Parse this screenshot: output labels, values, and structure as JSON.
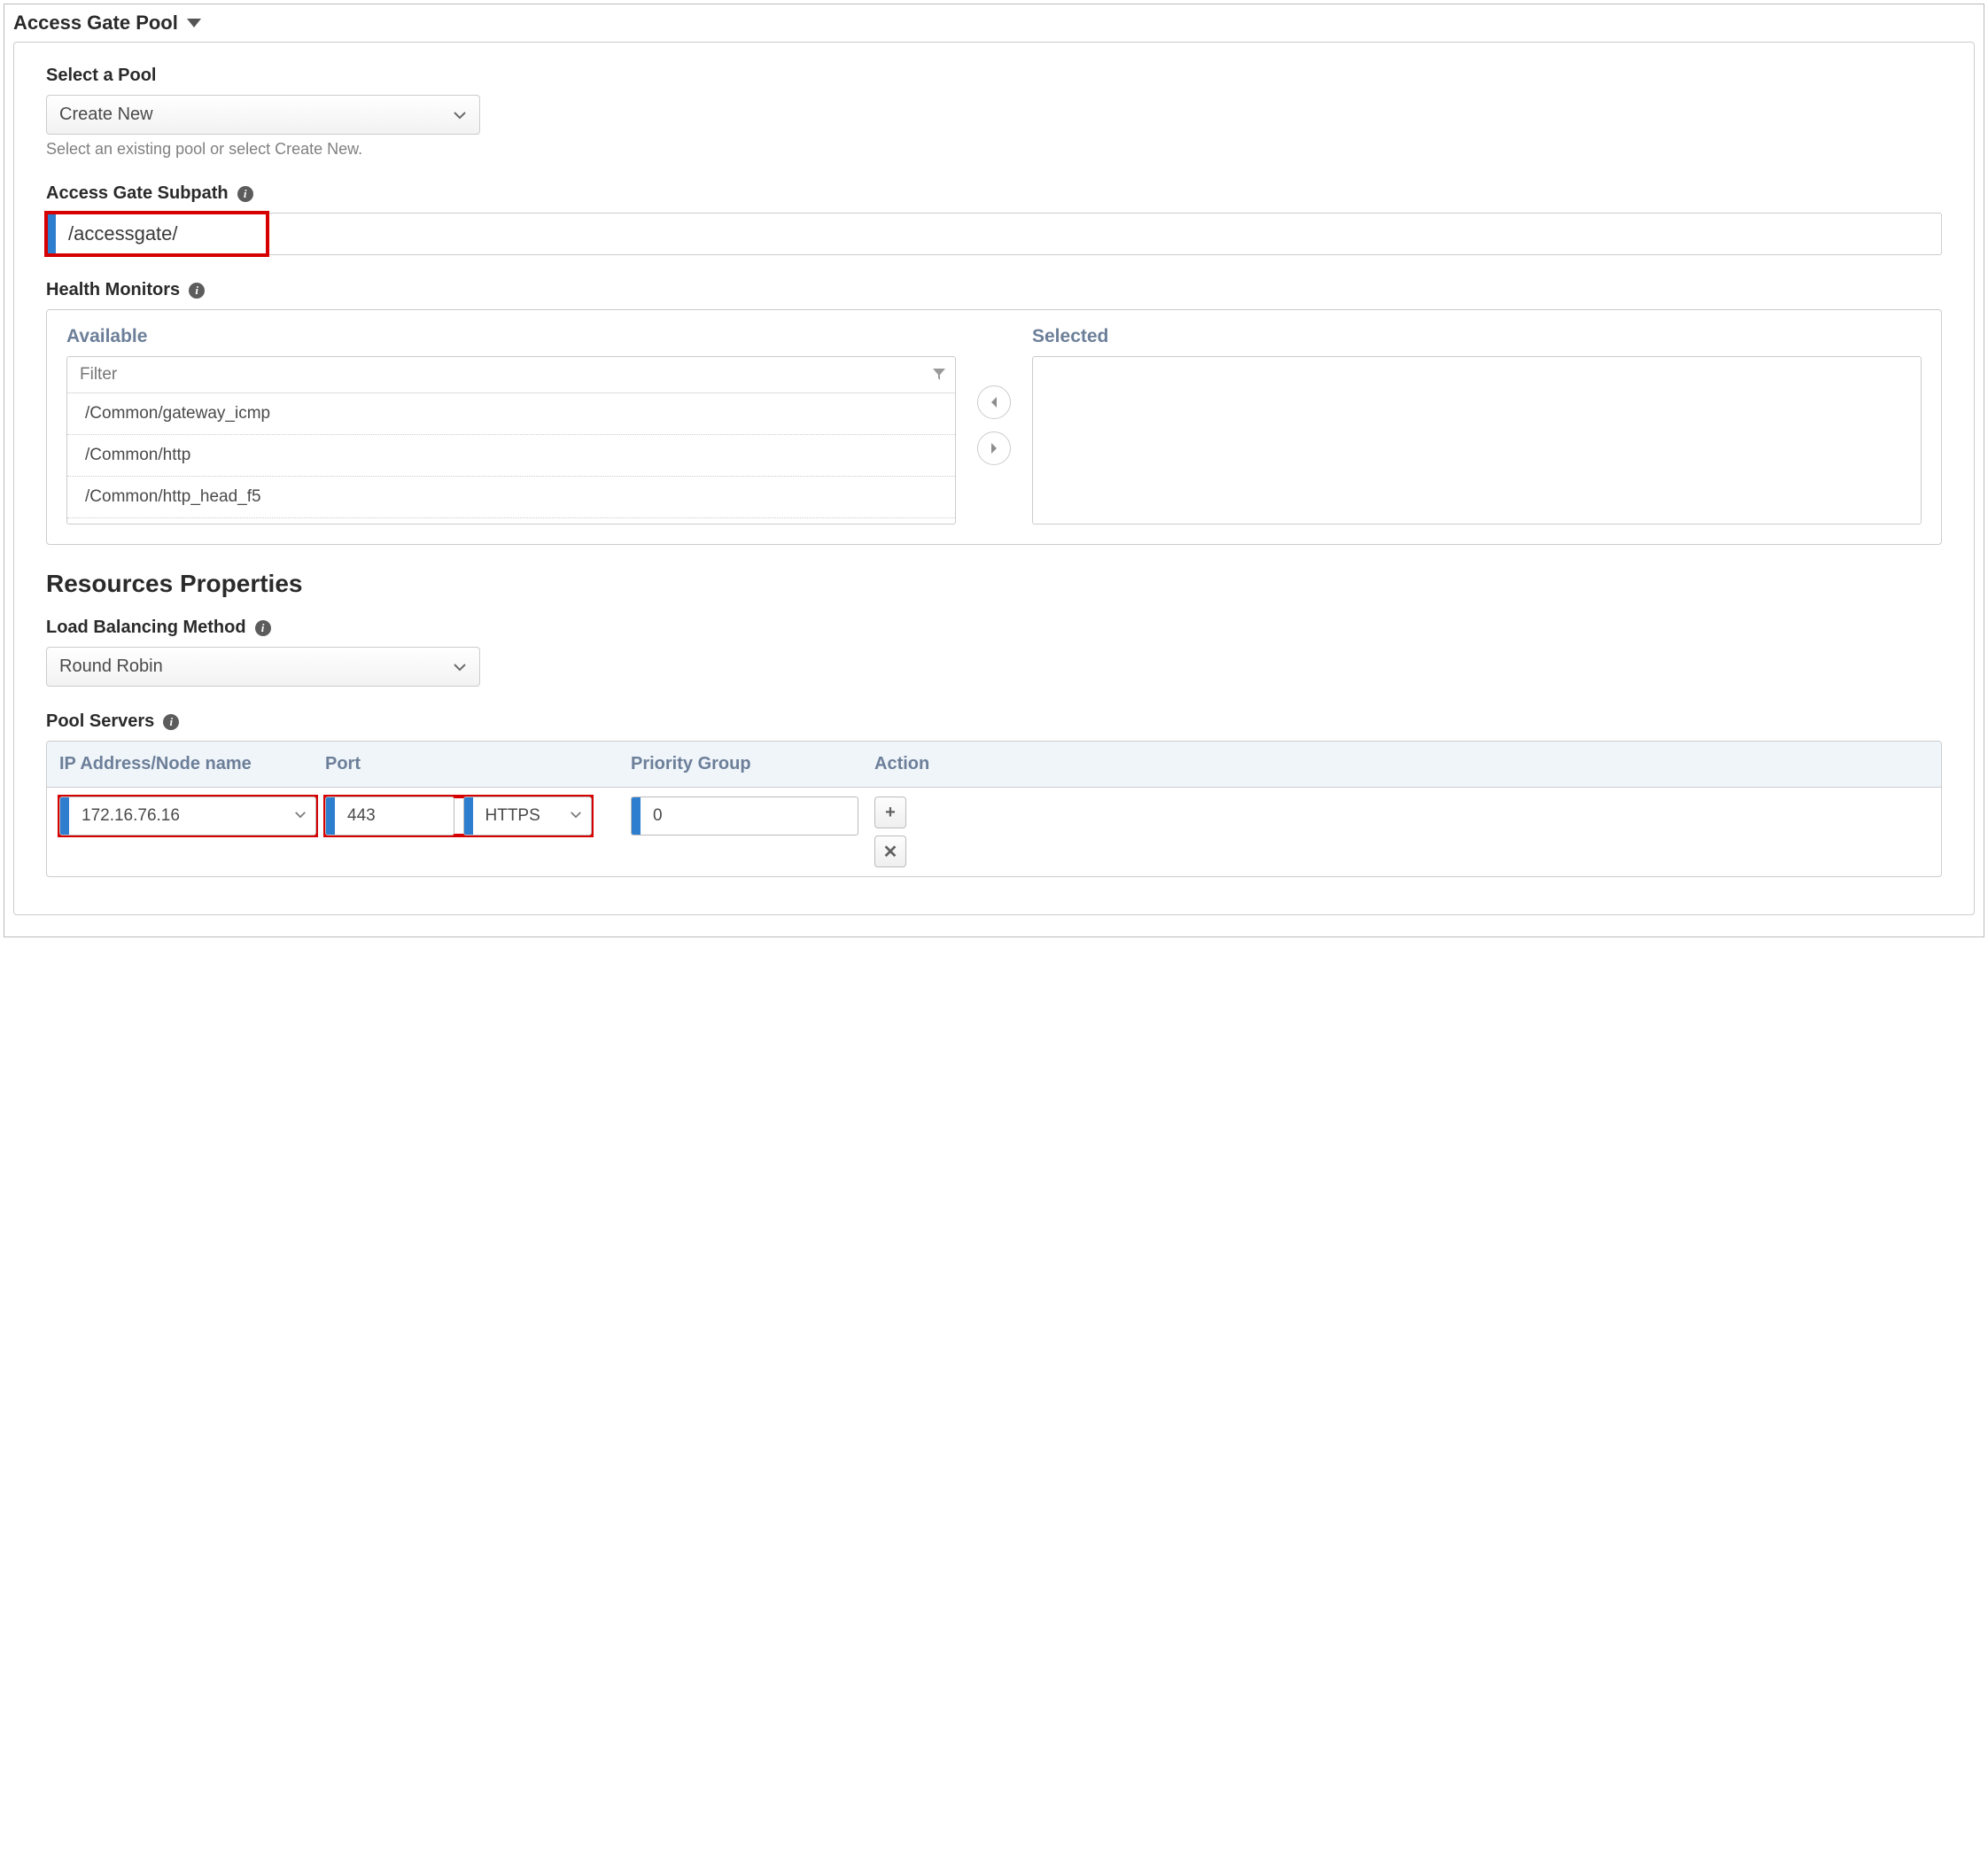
{
  "section_title": "Access Gate Pool",
  "select_pool": {
    "label": "Select a Pool",
    "value": "Create New",
    "help": "Select an existing pool or select Create New."
  },
  "subpath": {
    "label": "Access Gate Subpath",
    "value": "/accessgate/"
  },
  "health_monitors": {
    "label": "Health Monitors",
    "available_label": "Available",
    "selected_label": "Selected",
    "filter_placeholder": "Filter",
    "items": [
      "/Common/gateway_icmp",
      "/Common/http",
      "/Common/http_head_f5"
    ]
  },
  "resources": {
    "title": "Resources Properties",
    "lb": {
      "label": "Load Balancing Method",
      "value": "Round Robin"
    },
    "pool_servers_label": "Pool Servers",
    "columns": {
      "ip": "IP Address/Node name",
      "port": "Port",
      "priority": "Priority Group",
      "action": "Action"
    },
    "row": {
      "ip": "172.16.76.16",
      "port_num": "443",
      "port_proto": "HTTPS",
      "priority": "0"
    }
  }
}
